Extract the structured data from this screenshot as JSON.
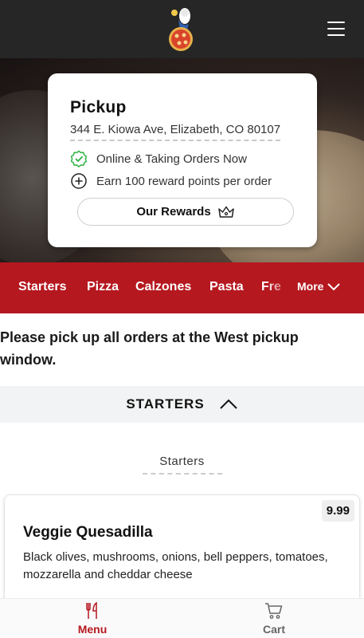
{
  "header": {
    "logo_icon": "pizza-chef-logo",
    "menu_icon": "hamburger-menu-icon"
  },
  "location_card": {
    "title": "Pickup",
    "address": "344 E. Kiowa Ave, Elizabeth, CO 80107",
    "status": "Online & Taking Orders Now",
    "rewards_note": "Earn 100 reward points per order",
    "rewards_button": "Our Rewards",
    "status_color": "#2fb344"
  },
  "categories": {
    "items": [
      "Starters",
      "Pizza",
      "Calzones",
      "Pasta",
      "Fre"
    ],
    "more_label": "More",
    "bar_color": "#b5181f"
  },
  "notice": "Please pick up all orders at the West pickup window.",
  "section": {
    "title": "STARTERS"
  },
  "subcategory": "Starters",
  "menu_items": [
    {
      "name": "Veggie Quesadilla",
      "price": "9.99",
      "description": "Black olives, mushrooms, onions, bell peppers, tomatoes, mozzarella and cheddar cheese"
    }
  ],
  "bottom_nav": {
    "menu_label": "Menu",
    "cart_label": "Cart",
    "active_color": "#b5181f"
  }
}
